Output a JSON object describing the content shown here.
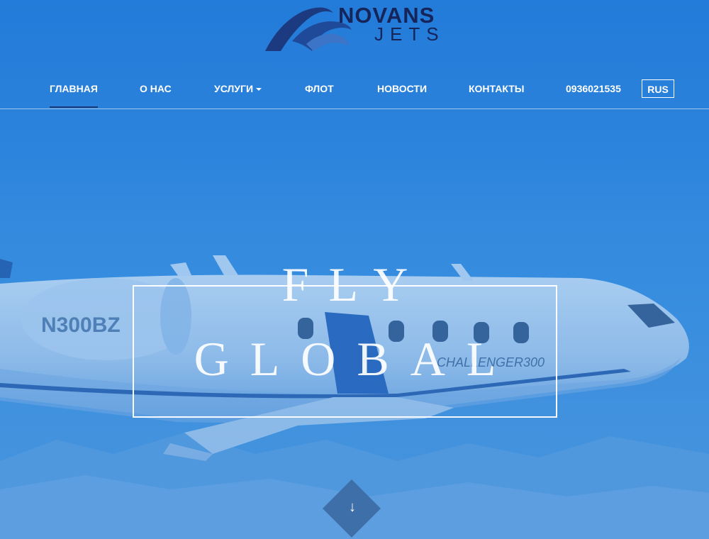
{
  "logo": {
    "line1": "NOVANS",
    "line2": "JETS"
  },
  "nav": {
    "items": [
      {
        "label": "ГЛАВНАЯ",
        "active": true
      },
      {
        "label": "О НАС"
      },
      {
        "label": "УСЛУГИ",
        "dropdown": true
      },
      {
        "label": "ФЛОТ"
      },
      {
        "label": "НОВОСТИ"
      },
      {
        "label": "КОНТАКТЫ"
      },
      {
        "label": "0936021535"
      }
    ],
    "language": "RUS"
  },
  "hero": {
    "line1": "FLY",
    "line2": "GLOBAL",
    "aircraft_registration": "N300BZ",
    "aircraft_model": "CHALLENGER 300",
    "scroll_icon": "arrow-down-icon"
  },
  "colors": {
    "sky": "#2f86d8",
    "logo_text": "#15255a",
    "nav_text": "#ffffff",
    "scroll_button": "#3e6fa8"
  }
}
